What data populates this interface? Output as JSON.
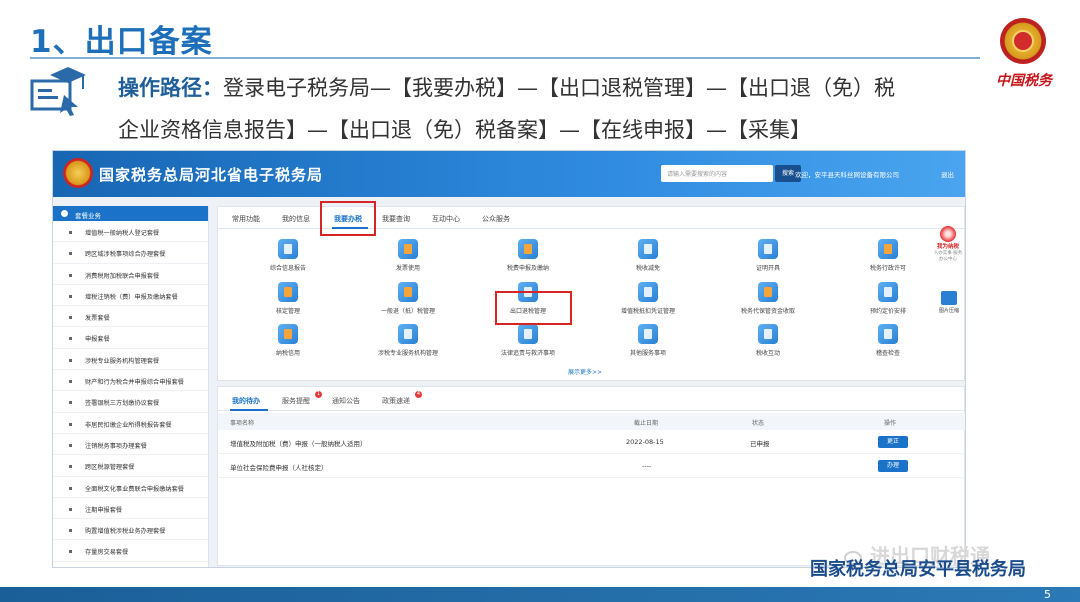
{
  "slide": {
    "title": "1、出口备案",
    "path_label": "操作路径：",
    "path_line1": "登录电子税务局—【我要办税】—【出口退税管理】—【出口退（免）税",
    "path_line2": "企业资格信息报告】—【出口退（免）税备案】—【在线申报】—【采集】",
    "brand_text": "中国税务",
    "footer_wechat": "进出口财税通",
    "footer_org": "国家税务总局安平县税务局",
    "page_number": "5"
  },
  "portal": {
    "title": "国家税务总局河北省电子税务局",
    "search_placeholder": "请输入需要搜索的内容",
    "search_button": "搜索",
    "welcome": "欢迎，安平县天科丝网设备有限公司",
    "logout": "退出",
    "left_menu_title": "套餐业务",
    "left_menu_items": [
      "增值税一般纳税人登记套餐",
      "跨区域涉税事项综合办理套餐",
      "消费税附加税联合申报套餐",
      "增税注销税（费）申报及缴纳套餐",
      "发票套餐",
      "申报套餐",
      "涉税专业服务机构管理套餐",
      "财产和行为税合并申报综合申报套餐",
      "签署银税三方划缴协议套餐",
      "非居民扣缴企业所得税报告套餐",
      "注销税务事项办理套餐",
      "跨区税源管理套餐",
      "全面税文化事业费联合申报缴纳套餐",
      "注期申报套餐",
      "购置增值税涉税业务办理套餐",
      "存量房交易套餐"
    ],
    "tabs": [
      "常用功能",
      "我的信息",
      "我要办税",
      "我要查询",
      "互动中心",
      "公众服务"
    ],
    "active_tab": "我要办税",
    "functions": [
      "综合信息报告",
      "发票使用",
      "税费申报及缴纳",
      "税收减免",
      "证明开具",
      "税务行政许可",
      "核定管理",
      "一般退（抵）税管理",
      "出口退税管理",
      "增值税抵扣凭证管理",
      "税务代保管资金收取",
      "预约定价安排",
      "纳税信用",
      "涉税专业服务机构管理",
      "法律追责与救济事项",
      "其他服务事项",
      "税收互动",
      "稽查检查"
    ],
    "show_more": "展示更多>>",
    "side_badge_title": "我为纳税",
    "side_badge_sub": "人办实事·服务办公中心",
    "side_pic_label": "图片压缩",
    "todo_tabs": [
      "我的待办",
      "服务提醒",
      "通知公告",
      "政策速递"
    ],
    "todo_badges": [
      "1",
      "4"
    ],
    "table_headers": [
      "事项名称",
      "截止日期",
      "状态",
      "操作"
    ],
    "rows": [
      {
        "name": "增值税及附加税（费）申报（一般纳税人适用）",
        "date": "2022-08-15",
        "status": "已申报",
        "action": "更正"
      },
      {
        "name": "单位社会保险费申报（人社核定）",
        "date": "----",
        "status": "",
        "action": "办理"
      }
    ]
  }
}
